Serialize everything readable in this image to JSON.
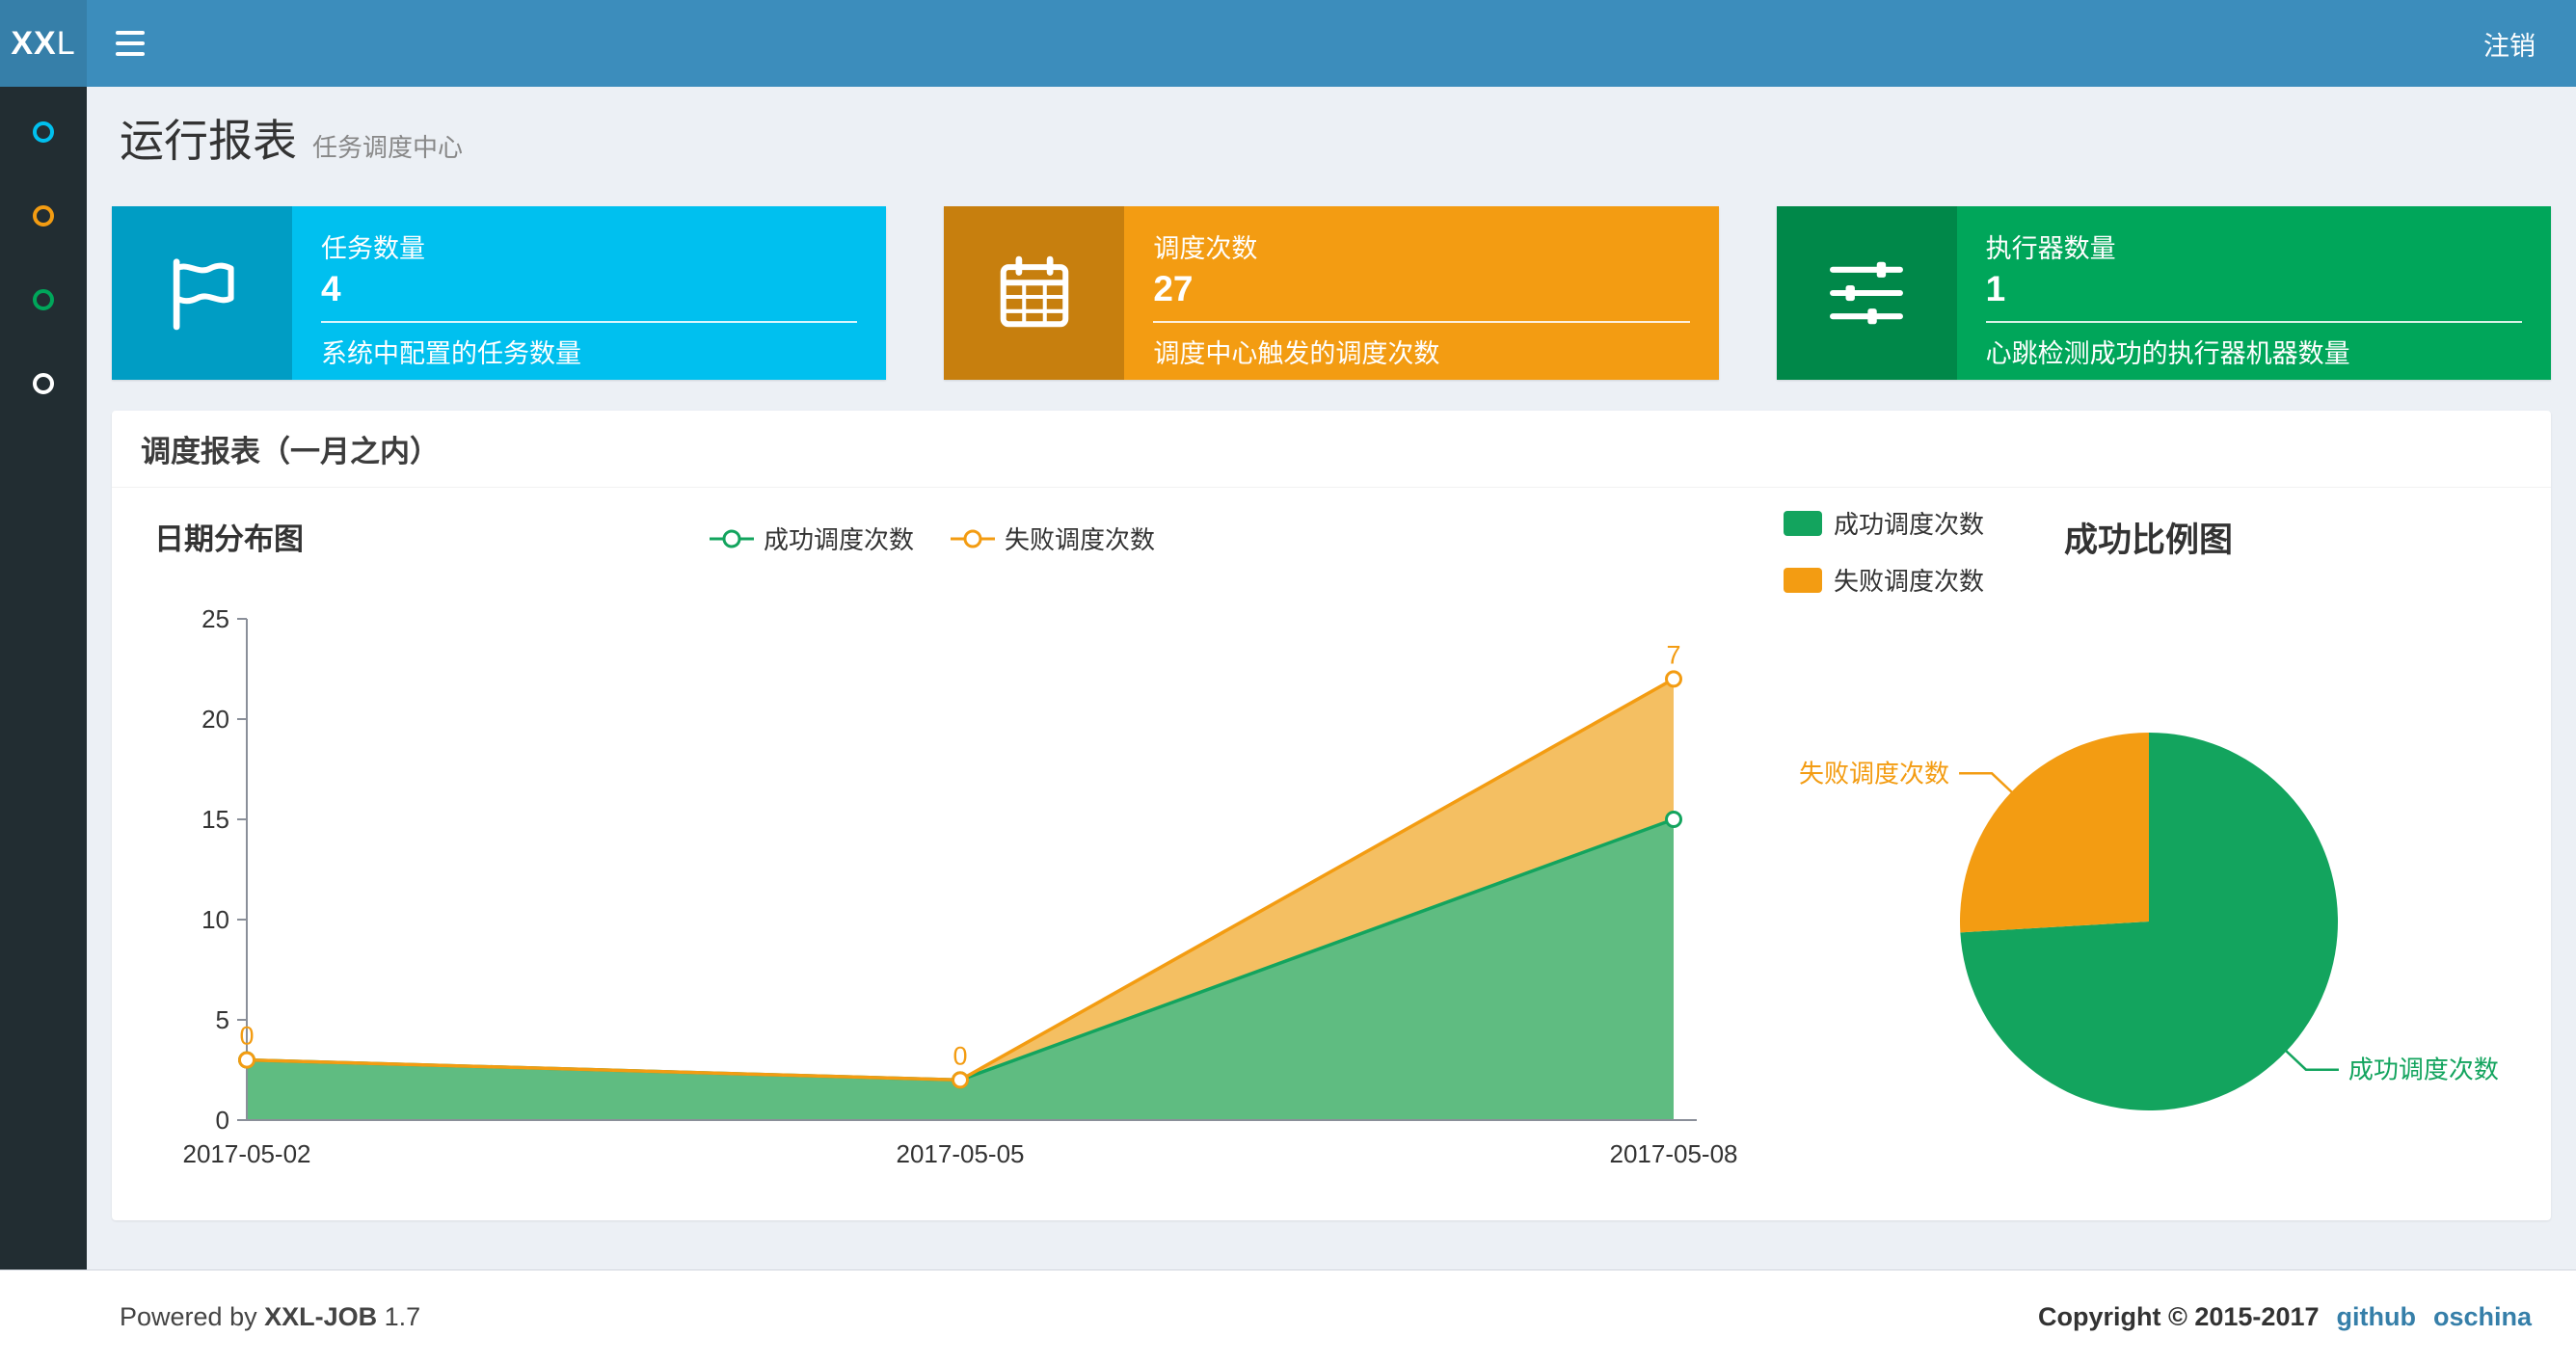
{
  "colors": {
    "navbar": "#3c8dbc",
    "logo-bg": "#367fa9",
    "sidebar-bg": "#222d32",
    "content-bg": "#ecf0f5",
    "link": "#367fa9"
  },
  "navbar": {
    "logo_bold": "XX",
    "logo_light": "L",
    "logout": "注销"
  },
  "sidebar": {
    "items": [
      {
        "icon": "circle-icon",
        "color": "#00c0ef"
      },
      {
        "icon": "circle-icon",
        "color": "#f39c12"
      },
      {
        "icon": "circle-icon",
        "color": "#00a65a"
      },
      {
        "icon": "circle-icon",
        "color": "#ffffff"
      }
    ]
  },
  "page": {
    "title": "运行报表",
    "subtitle": "任务调度中心"
  },
  "info_boxes": [
    {
      "icon": "flag-icon",
      "label": "任务数量",
      "value": "4",
      "desc": "系统中配置的任务数量",
      "bg": "#00c0ef"
    },
    {
      "icon": "calendar-icon",
      "label": "调度次数",
      "value": "27",
      "desc": "调度中心触发的调度次数",
      "bg": "#f39c12"
    },
    {
      "icon": "sliders-icon",
      "label": "执行器数量",
      "value": "1",
      "desc": "心跳检测成功的执行器机器数量",
      "bg": "#00a65a"
    }
  ],
  "panel": {
    "title": "调度报表（一月之内）"
  },
  "chart_data": [
    {
      "type": "area",
      "title": "日期分布图",
      "stacked": true,
      "x": [
        "2017-05-02",
        "2017-05-05",
        "2017-05-08"
      ],
      "series": [
        {
          "name": "成功调度次数",
          "values": [
            3,
            2,
            15
          ],
          "color": "#13a45e",
          "area_color": "#5fbc81"
        },
        {
          "name": "失败调度次数",
          "values": [
            0,
            0,
            7
          ],
          "color": "#f39c12",
          "area_color": "#f4bf62"
        }
      ],
      "point_labels": [
        "0",
        "0",
        "7"
      ],
      "ylim": [
        0,
        25
      ],
      "yticks": [
        0,
        5,
        10,
        15,
        20,
        25
      ],
      "legend_position": "top",
      "grid": false
    },
    {
      "type": "pie",
      "title": "成功比例图",
      "slices": [
        {
          "name": "成功调度次数",
          "value": 20,
          "color": "#13a45e"
        },
        {
          "name": "失败调度次数",
          "value": 7,
          "color": "#f39c12"
        }
      ],
      "legend_position": "top-left"
    }
  ],
  "footer": {
    "powered_prefix": "Powered by",
    "brand": "XXL-JOB",
    "version": "1.7",
    "copyright": "Copyright © 2015-2017",
    "links": [
      "github",
      "oschina"
    ]
  }
}
